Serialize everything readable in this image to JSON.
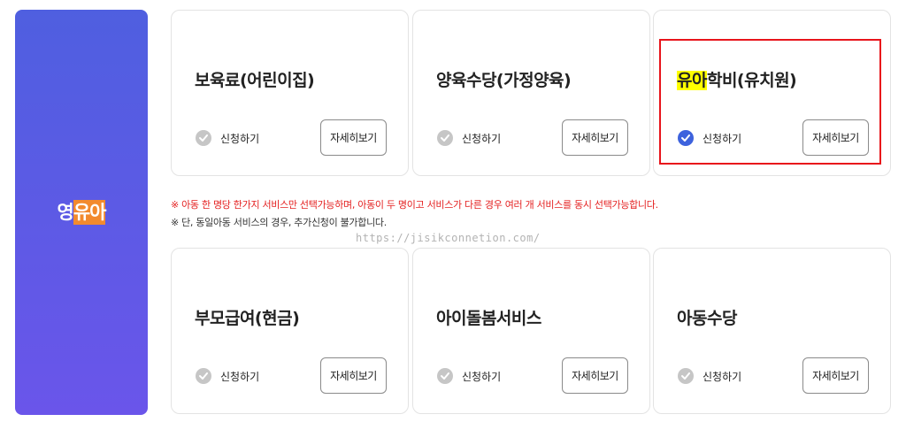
{
  "side_panel": {
    "title_plain": "영",
    "title_highlight": "유아"
  },
  "cards": [
    {
      "title": "보육료(어린이집)",
      "title_highlight": "",
      "apply_label": "신청하기",
      "detail_label": "자세히보기",
      "checked": false
    },
    {
      "title": "양육수당(가정양육)",
      "title_highlight": "",
      "apply_label": "신청하기",
      "detail_label": "자세히보기",
      "checked": false
    },
    {
      "title": "학비(유치원)",
      "title_highlight": "유아",
      "apply_label": "신청하기",
      "detail_label": "자세히보기",
      "checked": true
    },
    {
      "title": "부모급여(현금)",
      "title_highlight": "",
      "apply_label": "신청하기",
      "detail_label": "자세히보기",
      "checked": false
    },
    {
      "title": "아이돌봄서비스",
      "title_highlight": "",
      "apply_label": "신청하기",
      "detail_label": "자세히보기",
      "checked": false
    },
    {
      "title": "아동수당",
      "title_highlight": "",
      "apply_label": "신청하기",
      "detail_label": "자세히보기",
      "checked": false
    }
  ],
  "notices": {
    "red": "※ 아동 한 명당 한가지 서비스만 선택가능하며, 아동이 두 명이고 서비스가 다른 경우 여러 개 서비스를 동시 선택가능합니다.",
    "black": "※ 단, 동일아동 서비스의 경우, 추가신청이 불가합니다."
  },
  "watermark": "https://jisikconnetion.com/",
  "colors": {
    "panel_gradient_top": "#4f5fe0",
    "panel_gradient_bottom": "#6a55ea",
    "panel_highlight": "#f28a2e",
    "title_highlight": "#ffff00",
    "check_on": "#3d62dd",
    "check_off": "#c6c6c6",
    "selection_border": "#e8141b",
    "notice_red": "#e41e1e"
  }
}
